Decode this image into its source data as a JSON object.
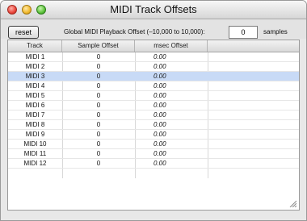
{
  "window": {
    "title": "MIDI Track Offsets"
  },
  "toolbar": {
    "reset_label": "reset",
    "offset_label": "Global MIDI Playback Offset (–10,000 to 10,000):",
    "offset_value": "0",
    "units_label": "samples"
  },
  "table": {
    "columns": [
      "Track",
      "Sample Offset",
      "msec Offset",
      ""
    ],
    "rows": [
      {
        "track": "MIDI 1",
        "samples": "0",
        "msec": "0.00"
      },
      {
        "track": "MIDI 2",
        "samples": "0",
        "msec": "0.00"
      },
      {
        "track": "MIDI 3",
        "samples": "0",
        "msec": "0.00"
      },
      {
        "track": "MIDI 4",
        "samples": "0",
        "msec": "0.00"
      },
      {
        "track": "MIDI 5",
        "samples": "0",
        "msec": "0.00"
      },
      {
        "track": "MIDI 6",
        "samples": "0",
        "msec": "0.00"
      },
      {
        "track": "MIDI 7",
        "samples": "0",
        "msec": "0.00"
      },
      {
        "track": "MIDI 8",
        "samples": "0",
        "msec": "0.00"
      },
      {
        "track": "MIDI 9",
        "samples": "0",
        "msec": "0.00"
      },
      {
        "track": "MIDI 10",
        "samples": "0",
        "msec": "0.00"
      },
      {
        "track": "MIDI 11",
        "samples": "0",
        "msec": "0.00"
      },
      {
        "track": "MIDI 12",
        "samples": "0",
        "msec": "0.00"
      }
    ],
    "selected_row_track": "MIDI 3"
  },
  "colors": {
    "selection": "#c8daf6",
    "close": "#e8443a",
    "minimize": "#f0b82c",
    "zoom": "#5cc23a"
  }
}
